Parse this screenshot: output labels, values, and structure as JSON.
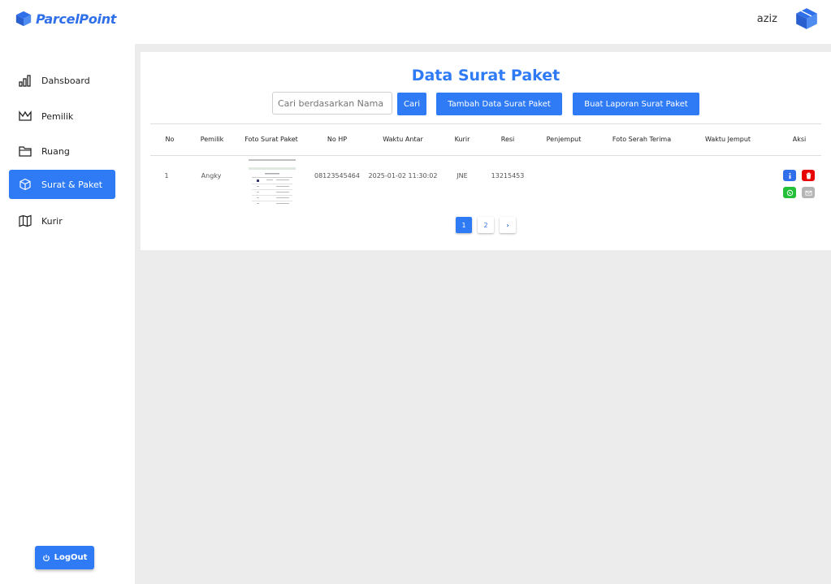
{
  "app": {
    "brand": "ParcelPoint",
    "user": "aziz"
  },
  "sidebar": {
    "items": [
      {
        "label": "Dahsboard",
        "icon": "bar-chart-icon",
        "active": false
      },
      {
        "label": "Pemilik",
        "icon": "crown-icon",
        "active": false
      },
      {
        "label": "Ruang",
        "icon": "folder-icon",
        "active": false
      },
      {
        "label": "Surat & Paket",
        "icon": "box-icon",
        "active": true
      },
      {
        "label": "Kurir",
        "icon": "map-icon",
        "active": false
      }
    ],
    "logout_label": "LogOut"
  },
  "main": {
    "title": "Data Surat Paket",
    "search_placeholder": "Cari berdasarkan Nama",
    "search_button": "Cari",
    "add_button": "Tambah Data Surat Paket",
    "report_button": "Buat Laporan Surat Paket",
    "table": {
      "columns": [
        "No",
        "Pemilik",
        "Foto Surat Paket",
        "No HP",
        "Waktu Antar",
        "Kurir",
        "Resi",
        "Penjemput",
        "Foto Serah Terima",
        "Waktu Jemput",
        "Aksi"
      ],
      "rows": [
        {
          "no": "1",
          "pemilik": "Angky",
          "no_hp": "08123545464",
          "waktu_antar": "2025-01-02 11:30:02",
          "kurir": "JNE",
          "resi": "13215453",
          "penjemput": "",
          "foto_serah_terima": "",
          "waktu_jemput": ""
        }
      ]
    },
    "pagination": {
      "pages": [
        "1",
        "2"
      ],
      "current": "1",
      "next": "›"
    }
  },
  "colors": {
    "accent": "#2f7bf5",
    "danger": "#e60000",
    "whatsapp": "#25c03a",
    "muted": "#b5b5b5",
    "info": "#2f6fea"
  }
}
